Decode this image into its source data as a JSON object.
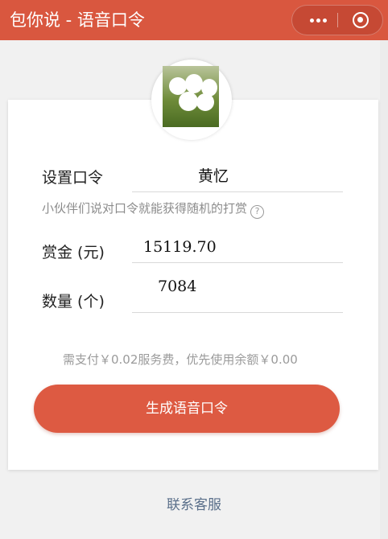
{
  "navbar": {
    "title": "包你说 - 语音口令",
    "accent_color": "#d9573f",
    "more_icon": "more-dots-icon",
    "close_icon": "close-circle-icon"
  },
  "form": {
    "password_label": "设置口令",
    "password_value": "黄忆",
    "password_prefix_mark": "",
    "hint": "小伙伴们说对口令就能获得随机的打赏",
    "help_icon_glyph": "?",
    "amount_label": "赏金 (元)",
    "amount_value": "15119.70",
    "count_label": "数量 (个)",
    "count_value": "7084"
  },
  "fee_text": "需支付￥0.02服务费，优先使用余额￥0.00",
  "submit_label": "生成语音口令",
  "service_link": "联系客服"
}
